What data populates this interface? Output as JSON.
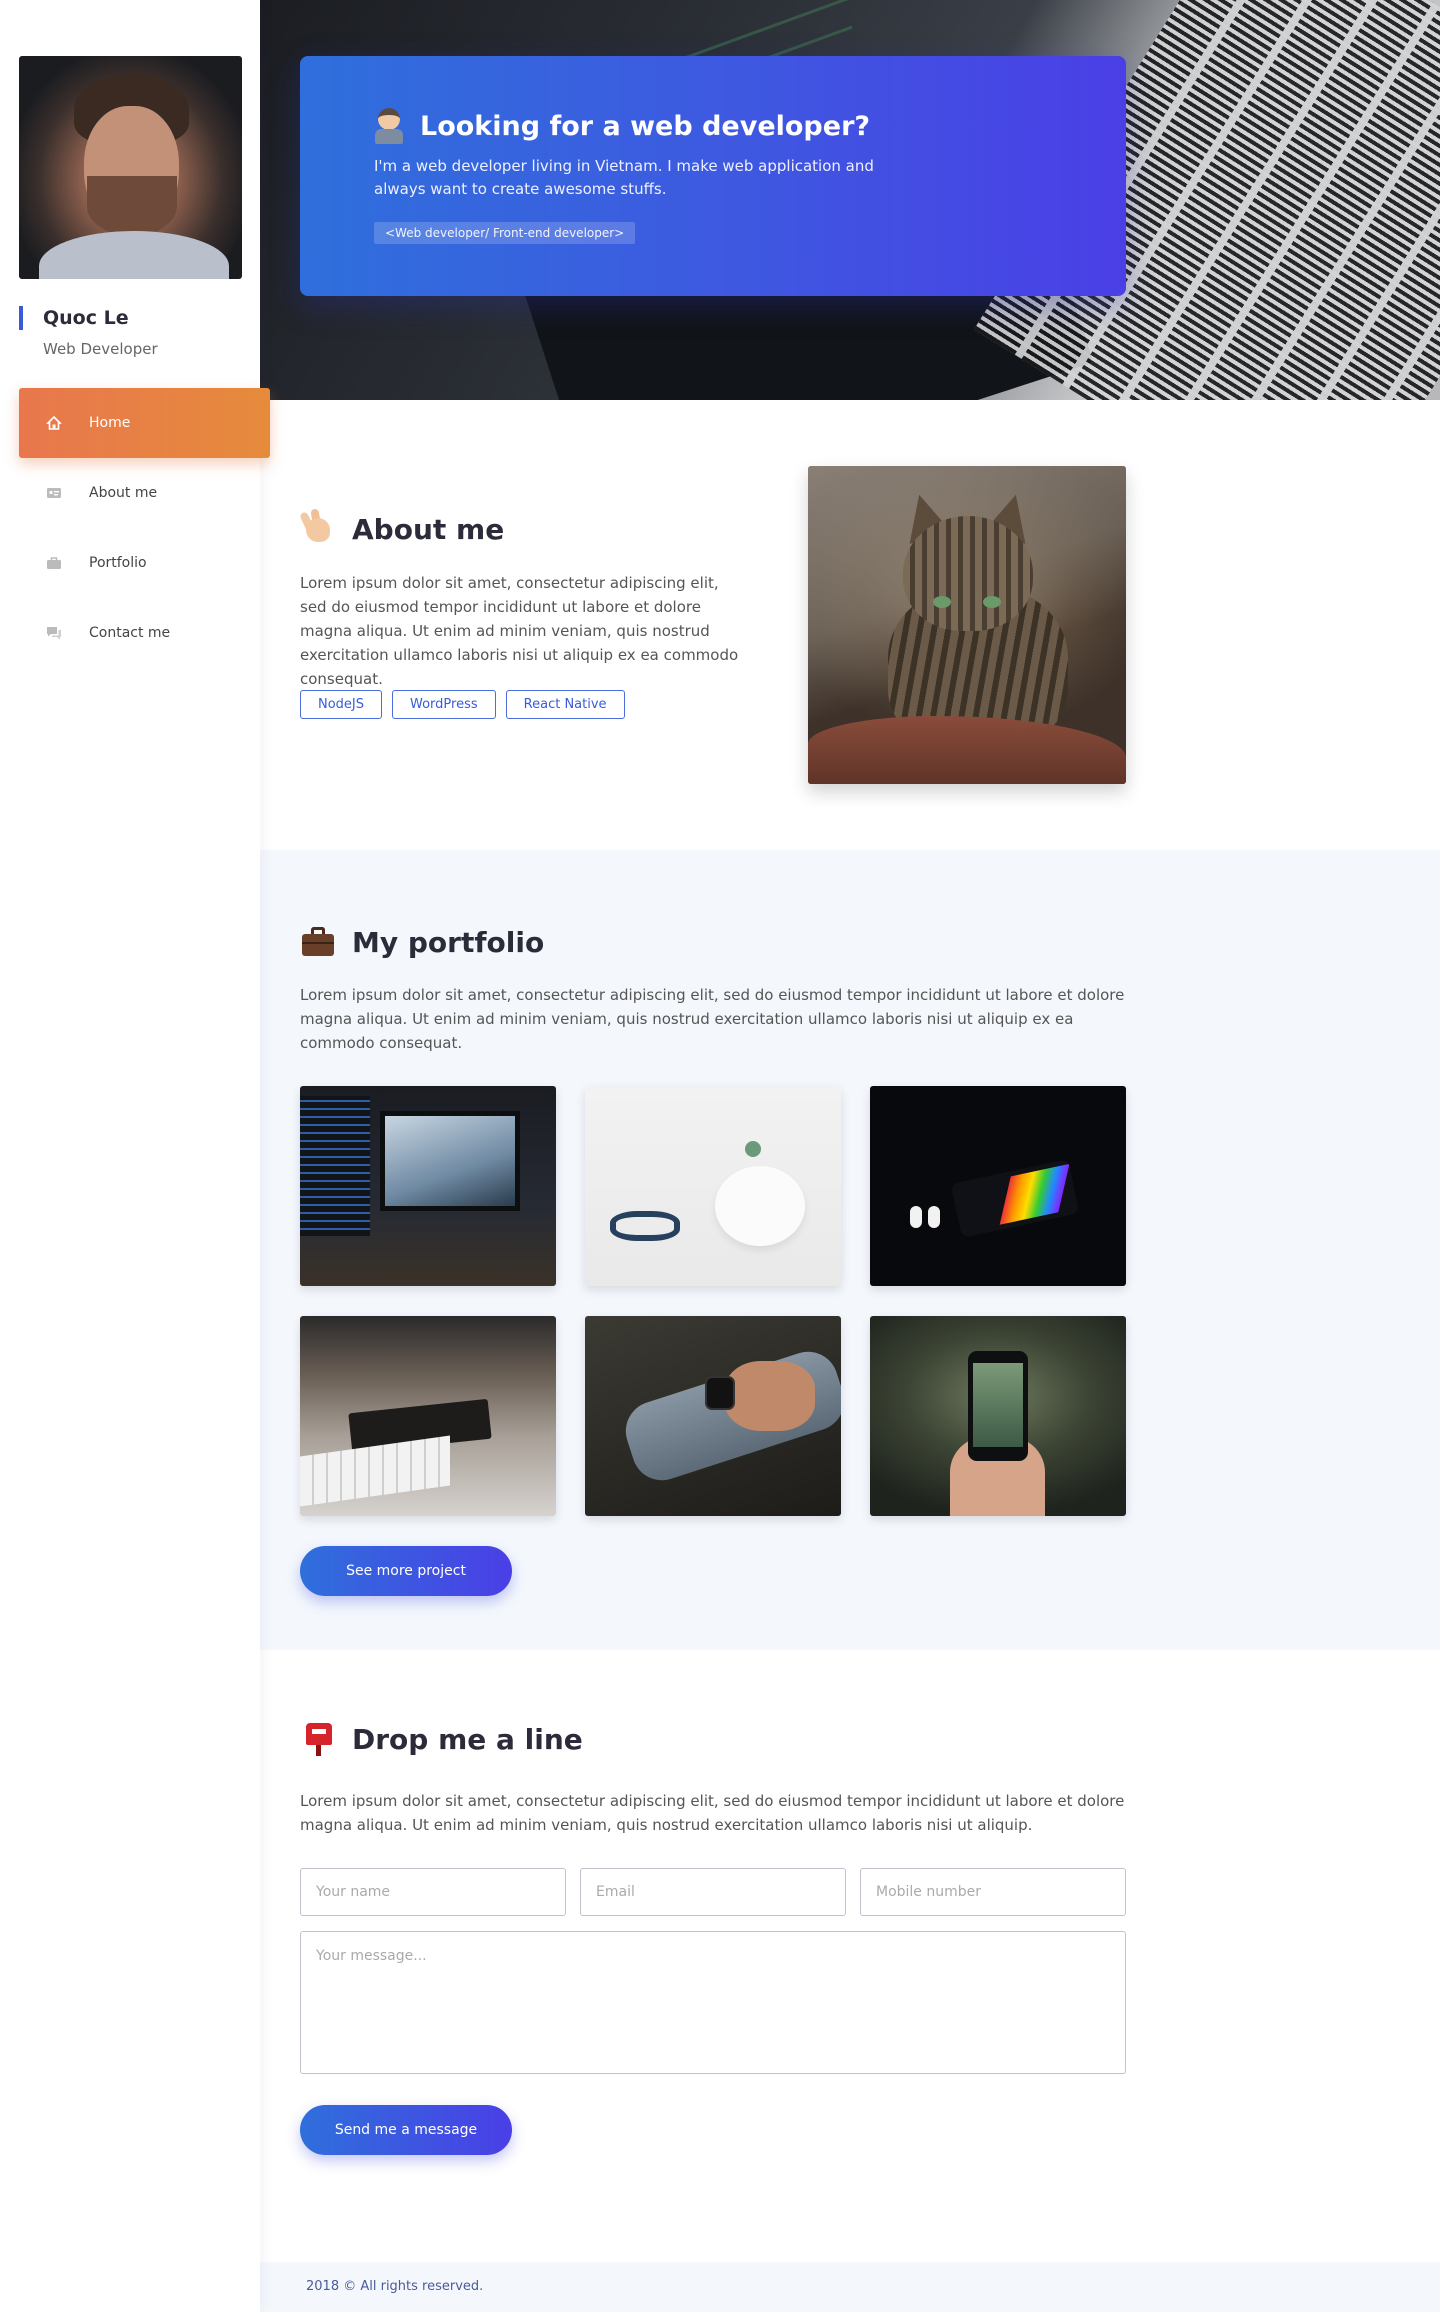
{
  "profile": {
    "name": "Quoc Le",
    "role": "Web Developer"
  },
  "nav": {
    "items": [
      {
        "label": "Home",
        "icon": "home-icon",
        "active": true
      },
      {
        "label": "About me",
        "icon": "id-card-icon",
        "active": false
      },
      {
        "label": "Portfolio",
        "icon": "briefcase-icon",
        "active": false
      },
      {
        "label": "Contact me",
        "icon": "chat-icon",
        "active": false
      }
    ]
  },
  "hero": {
    "title": "Looking for a web developer?",
    "description": "I'm a web developer living in Vietnam. I make web application and always want to create awesome stuffs.",
    "tag": "<Web developer/ Front-end developer>"
  },
  "about": {
    "title": "About me",
    "text": "Lorem ipsum dolor sit amet, consectetur adipiscing elit, sed do eiusmod tempor incididunt ut labore et dolore magna aliqua. Ut enim ad minim veniam, quis nostrud exercitation ullamco laboris nisi ut aliquip ex ea commodo consequat.",
    "skills": [
      "NodeJS",
      "WordPress",
      "React Native"
    ]
  },
  "portfolio": {
    "title": "My portfolio",
    "text": "Lorem ipsum dolor sit amet, consectetur adipiscing elit, sed do eiusmod tempor incididunt ut labore et dolore magna aliqua. Ut enim ad minim veniam, quis nostrud exercitation ullamco laboris nisi ut aliquip ex ea commodo consequat.",
    "see_more_label": "See more project"
  },
  "contact": {
    "title": "Drop me a line",
    "text": "Lorem ipsum dolor sit amet, consectetur adipiscing elit, sed do eiusmod tempor incididunt ut labore et dolore magna aliqua. Ut enim ad minim veniam, quis nostrud exercitation ullamco laboris nisi ut aliquip.",
    "name_placeholder": "Your name",
    "email_placeholder": "Email",
    "mobile_placeholder": "Mobile number",
    "message_placeholder": "Your message...",
    "send_label": "Send me a message"
  },
  "footer": {
    "text": "2018 © All rights reserved."
  },
  "colors": {
    "accent_blue": "#3a5bd9",
    "accent_orange": "#e8774d",
    "section_bg": "#f4f8fd"
  }
}
